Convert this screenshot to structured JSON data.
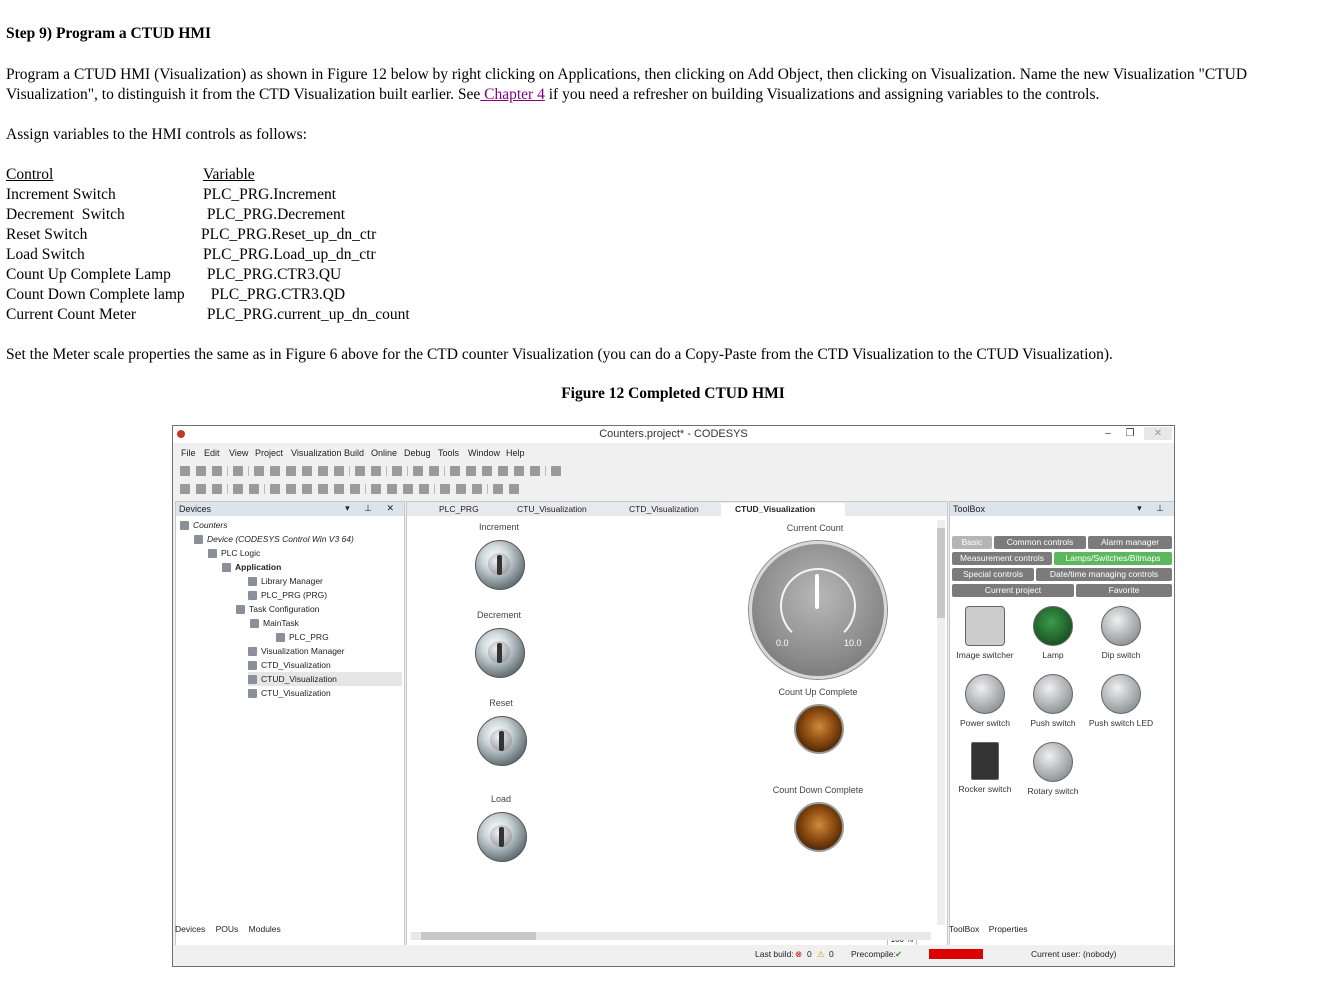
{
  "step_title": "Step 9)  Program a CTUD HMI",
  "intro": {
    "part1": "Program a CTUD HMI (Visualization) as shown in Figure 12 below by right clicking on Applications, then clicking on Add Object, then clicking on Visualization.  Name the new Visualization \"CTUD Visualization\", to distinguish it from the CTD Visualization built earlier.  See",
    "link": " Chapter 4",
    "part2": " if you need a refresher on building Visualizations and assigning variables to the controls."
  },
  "assign_text": "Assign variables to the HMI controls as follows:",
  "table": {
    "headers": [
      "Control",
      "Variable"
    ],
    "rows": [
      [
        "Increment Switch",
        "PLC_PRG.Increment"
      ],
      [
        "Decrement  Switch",
        " PLC_PRG.Decrement"
      ],
      [
        "Reset Switch",
        "PLC_PRG.Reset_up_dn_ctr"
      ],
      [
        "Load Switch",
        "PLC_PRG.Load_up_dn_ctr"
      ],
      [
        "Count Up Complete Lamp",
        " PLC_PRG.CTR3.QU"
      ],
      [
        "Count Down Complete lamp",
        "  PLC_PRG.CTR3.QD"
      ],
      [
        "Current Count Meter",
        " PLC_PRG.current_up_dn_count"
      ]
    ]
  },
  "meter_note": "Set the Meter scale properties the same as in Figure 6 above for the CTD counter Visualization (you can do a Copy-Paste from the CTD Visualization to the CTUD Visualization).",
  "figure_caption": "Figure 12 Completed CTUD HMI",
  "screenshot": {
    "window_title": "Counters.project* - CODESYS",
    "menu": [
      "File",
      "Edit",
      "View",
      "Project",
      "Visualization",
      "Build",
      "Online",
      "Debug",
      "Tools",
      "Window",
      "Help"
    ],
    "devices_panel": {
      "title": "Devices",
      "tree": [
        "Counters",
        "Device (CODESYS Control Win V3 64)",
        "PLC Logic",
        "Application",
        "Library Manager",
        "PLC_PRG (PRG)",
        "Task Configuration",
        "MainTask",
        "PLC_PRG",
        "Visualization Manager",
        "CTD_Visualization",
        "CTUD_Visualization",
        "CTU_Visualization"
      ],
      "footer": [
        "Devices",
        "POUs",
        "Modules"
      ]
    },
    "tabs": [
      "PLC_PRG",
      "CTU_Visualization",
      "CTD_Visualization",
      "CTUD_Visualization"
    ],
    "canvas": {
      "increment": "Increment",
      "decrement": "Decrement",
      "reset": "Reset",
      "load": "Load",
      "current_count": "Current Count",
      "meter_min": "0.0",
      "meter_max": "10.0",
      "count_up": "Count Up Complete",
      "count_down": "Count Down Complete",
      "zoom": "100 %"
    },
    "toolbox": {
      "title": "ToolBox",
      "categories": [
        "Basic",
        "Common controls",
        "Alarm manager",
        "Measurement controls",
        "Lamps/Switches/Bitmaps",
        "Special controls",
        "Date/time managing controls",
        "Current project",
        "Favorite"
      ],
      "items": [
        "Image switcher",
        "Lamp",
        "Dip switch",
        "Power switch",
        "Push switch",
        "Push switch LED",
        "Rocker switch",
        "Rotary switch"
      ],
      "footer": [
        "ToolBox",
        "Properties"
      ]
    },
    "status": {
      "last_build": "Last build:",
      "errors": "0",
      "warnings": "0",
      "precompile": "Precompile:",
      "current_user": "Current user: (nobody)"
    }
  }
}
